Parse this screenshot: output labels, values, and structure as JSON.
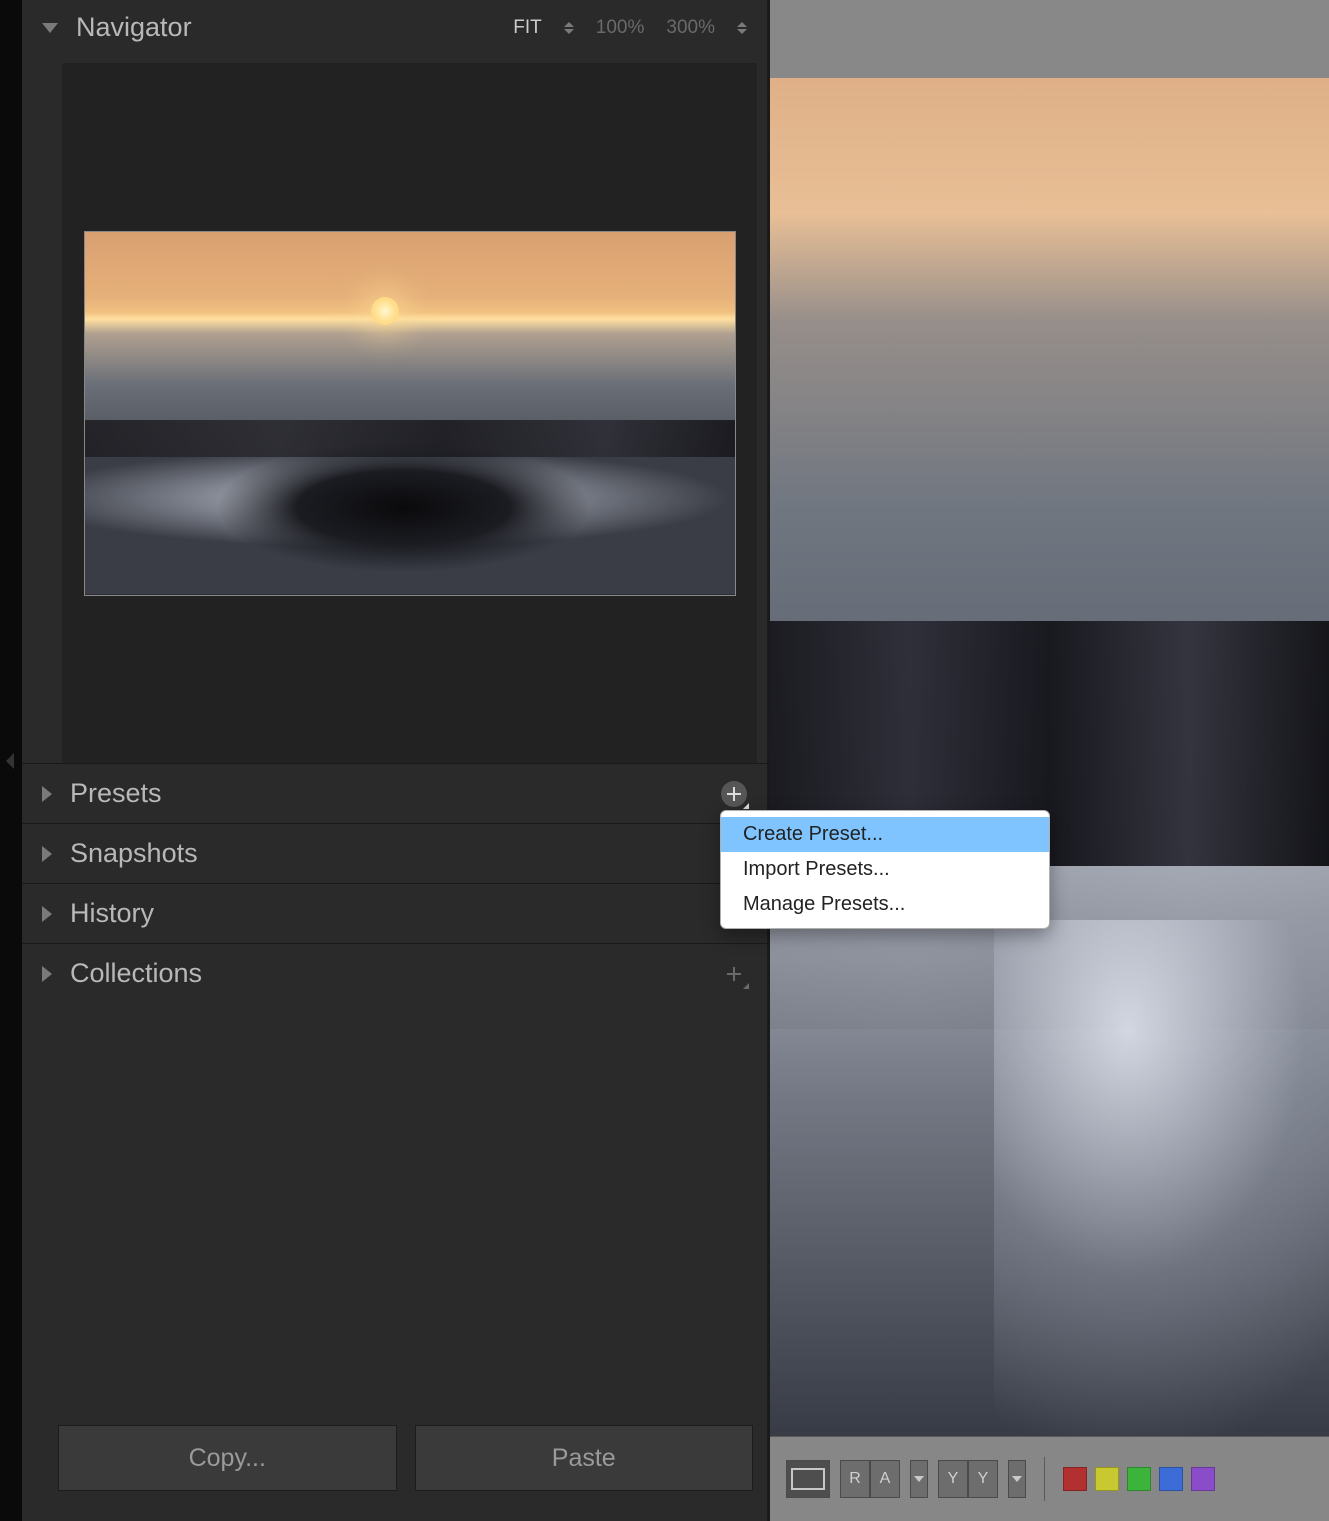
{
  "navigator": {
    "title": "Navigator",
    "zoom": {
      "fit": "FIT",
      "p100": "100%",
      "p300": "300%"
    }
  },
  "panels": {
    "presets": "Presets",
    "snapshots": "Snapshots",
    "history": "History",
    "collections": "Collections"
  },
  "buttons": {
    "copy": "Copy...",
    "paste": "Paste"
  },
  "contextMenu": {
    "create": "Create Preset...",
    "import": "Import Presets...",
    "manage": "Manage Presets..."
  },
  "viewModeSegmentA": {
    "left": "R",
    "right": "A"
  },
  "viewModeSegmentB": {
    "left": "Y",
    "right": "Y"
  },
  "colorLabels": [
    "#b33030",
    "#c8c830",
    "#3cb43c",
    "#3c6cd8",
    "#8a4cc8"
  ]
}
